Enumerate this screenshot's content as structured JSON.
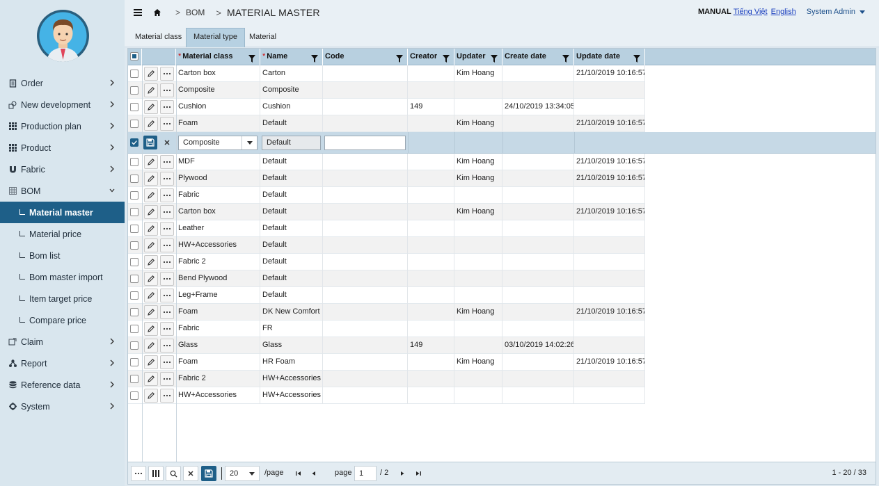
{
  "sidebar": {
    "items": [
      {
        "label": "Order",
        "icon": "document-icon"
      },
      {
        "label": "New development",
        "icon": "shapes-icon"
      },
      {
        "label": "Production plan",
        "icon": "grid-icon"
      },
      {
        "label": "Product",
        "icon": "grid-icon"
      },
      {
        "label": "Fabric",
        "icon": "magnet-icon"
      },
      {
        "label": "BOM",
        "icon": "table-icon",
        "expanded": true
      },
      {
        "label": "Material master",
        "sub": true,
        "active": true
      },
      {
        "label": "Material price",
        "sub": true
      },
      {
        "label": "Bom list",
        "sub": true
      },
      {
        "label": "Bom master import",
        "sub": true
      },
      {
        "label": "Item target price",
        "sub": true
      },
      {
        "label": "Compare price",
        "sub": true
      },
      {
        "label": "Claim",
        "icon": "claim-icon"
      },
      {
        "label": "Report",
        "icon": "sitemap-icon"
      },
      {
        "label": "Reference data",
        "icon": "database-icon"
      },
      {
        "label": "System",
        "icon": "gear-icon"
      }
    ]
  },
  "header": {
    "breadcrumb_1": "BOM",
    "page_title": "MATERIAL MASTER",
    "manual": "MANUAL",
    "lang_vi": "Tiếng Việt",
    "lang_en": "English",
    "user": "System Admin"
  },
  "tabs": [
    "Material class",
    "Material type",
    "Material"
  ],
  "active_tab": 1,
  "grid": {
    "columns": [
      {
        "label": "Material class",
        "required": true
      },
      {
        "label": "Name",
        "required": true
      },
      {
        "label": "Code",
        "required": false
      },
      {
        "label": "Creator",
        "required": false
      },
      {
        "label": "Updater",
        "required": false
      },
      {
        "label": "Create date",
        "required": false
      },
      {
        "label": "Update date",
        "required": false
      }
    ],
    "rows": [
      [
        "Carton box",
        "Carton",
        "",
        "",
        "Kim Hoang",
        "",
        "21/10/2019 10:16:57"
      ],
      [
        "Composite",
        "Composite",
        "",
        "",
        "",
        "",
        ""
      ],
      [
        "Cushion",
        "Cushion",
        "",
        "149",
        "",
        "24/10/2019 13:34:05",
        ""
      ],
      [
        "Foam",
        "Default",
        "",
        "",
        "Kim Hoang",
        "",
        "21/10/2019 10:16:57"
      ],
      [
        "MDF",
        "Default",
        "",
        "",
        "Kim Hoang",
        "",
        "21/10/2019 10:16:57"
      ],
      [
        "Plywood",
        "Default",
        "",
        "",
        "Kim Hoang",
        "",
        "21/10/2019 10:16:57"
      ],
      [
        "Fabric",
        "Default",
        "",
        "",
        "",
        "",
        ""
      ],
      [
        "Carton box",
        "Default",
        "",
        "",
        "Kim Hoang",
        "",
        "21/10/2019 10:16:57"
      ],
      [
        "Leather",
        "Default",
        "",
        "",
        "",
        "",
        ""
      ],
      [
        "HW+Accessories",
        "Default",
        "",
        "",
        "",
        "",
        ""
      ],
      [
        "Fabric 2",
        "Default",
        "",
        "",
        "",
        "",
        ""
      ],
      [
        "Bend Plywood",
        "Default",
        "",
        "",
        "",
        "",
        ""
      ],
      [
        "Leg+Frame",
        "Default",
        "",
        "",
        "",
        "",
        ""
      ],
      [
        "Foam",
        "DK New Comfort",
        "",
        "",
        "Kim Hoang",
        "",
        "21/10/2019 10:16:57"
      ],
      [
        "Fabric",
        "FR",
        "",
        "",
        "",
        "",
        ""
      ],
      [
        "Glass",
        "Glass",
        "",
        "149",
        "",
        "03/10/2019 14:02:26",
        ""
      ],
      [
        "Foam",
        "HR Foam",
        "",
        "",
        "Kim Hoang",
        "",
        "21/10/2019 10:16:57"
      ],
      [
        "Fabric 2",
        "HW+Accessories",
        "",
        "",
        "",
        "",
        ""
      ],
      [
        "HW+Accessories",
        "HW+Accessories",
        "",
        "",
        "",
        "",
        ""
      ]
    ],
    "edit_row": {
      "after_index": 3,
      "material_class": "Composite",
      "name": "Default",
      "code": ""
    }
  },
  "footer": {
    "page_size": "20",
    "per_page": "/page",
    "page_label": "page",
    "page": "1",
    "total_pages": "/ 2",
    "range": "1 - 20 / 33"
  }
}
